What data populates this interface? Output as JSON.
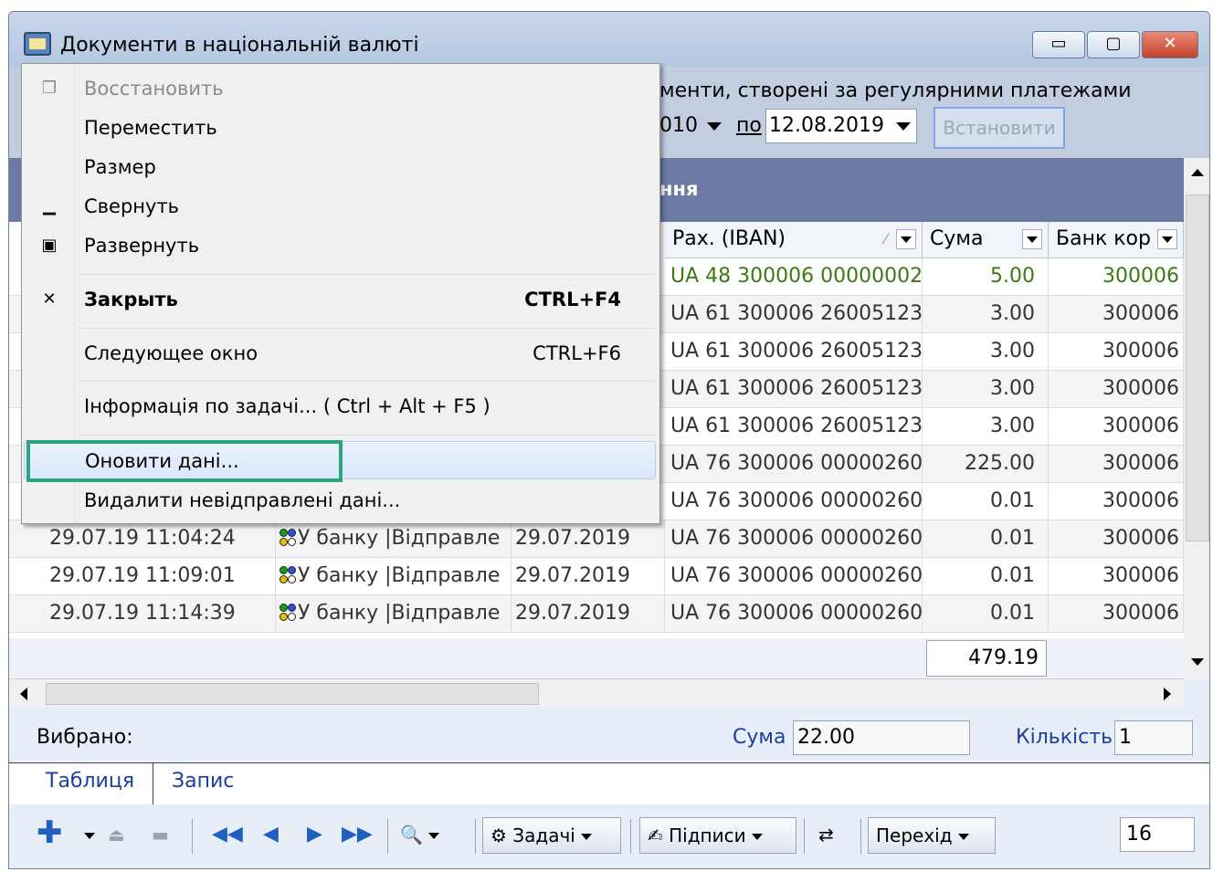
{
  "window": {
    "title": "Документи в національній валюті",
    "controls": {
      "minimize": "▭",
      "maximize": "▢",
      "close": "✕"
    }
  },
  "filter": {
    "title_fragment": "менти, створені за регулярними платежами",
    "date_from_fragment": "010",
    "to_label": "по",
    "date_to": "12.08.2019",
    "apply_button": "Встановити"
  },
  "table": {
    "group_header_fragment": "ння",
    "columns": {
      "iban": "Рах. (IBAN)",
      "sum": "Сума",
      "bank": "Банк кор"
    },
    "rows": [
      {
        "time": "",
        "status": "",
        "date": "",
        "iban": "UA 48 300006 00000002",
        "sum": "5.00",
        "bank": "300006",
        "green": true
      },
      {
        "time": "",
        "status": "",
        "date": "",
        "iban": "UA 61 300006 26005123",
        "sum": "3.00",
        "bank": "300006"
      },
      {
        "time": "",
        "status": "",
        "date": "",
        "iban": "UA 61 300006 26005123",
        "sum": "3.00",
        "bank": "300006"
      },
      {
        "time": "",
        "status": "",
        "date": "",
        "iban": "UA 61 300006 26005123",
        "sum": "3.00",
        "bank": "300006"
      },
      {
        "time": "",
        "status": "",
        "date": "",
        "iban": "UA 61 300006 26005123",
        "sum": "3.00",
        "bank": "300006"
      },
      {
        "time": "",
        "status": "",
        "date": "",
        "iban": "UA 76 300006 00000260",
        "sum": "225.00",
        "bank": "300006"
      },
      {
        "time": "",
        "status": "",
        "date": "",
        "iban": "UA 76 300006 00000260",
        "sum": "0.01",
        "bank": "300006"
      },
      {
        "time": "29.07.19 11:04:24",
        "status": "У банку |Відправле",
        "date": "29.07.2019",
        "iban": "UA 76 300006 00000260",
        "sum": "0.01",
        "bank": "300006"
      },
      {
        "time": "29.07.19 11:09:01",
        "status": "У банку |Відправле",
        "date": "29.07.2019",
        "iban": "UA 76 300006 00000260",
        "sum": "0.01",
        "bank": "300006"
      },
      {
        "time": "29.07.19 11:14:39",
        "status": "У банку |Відправле",
        "date": "29.07.2019",
        "iban": "UA 76 300006 00000260",
        "sum": "0.01",
        "bank": "300006"
      }
    ],
    "total": "479.19"
  },
  "selected": {
    "label": "Вибрано:",
    "sum_label": "Сума",
    "sum_value": "22.00",
    "count_label": "Кількість",
    "count_value": "1"
  },
  "tabs": [
    "Таблиця",
    "Запис"
  ],
  "toolbar": {
    "tasks": "Задачі",
    "signatures": "Підписи",
    "goto": "Перехід",
    "page": "16"
  },
  "menu": {
    "items": {
      "restore": "Восстановить",
      "move": "Переместить",
      "size": "Размер",
      "minimize": "Свернуть",
      "maximize": "Развернуть",
      "close": "Закрыть",
      "close_shortcut": "CTRL+F4",
      "next": "Следующее окно",
      "next_shortcut": "CTRL+F6",
      "info": "Інформація по задачі... ( Ctrl + Alt + F5 )",
      "refresh": "Оновити дані...",
      "delete": "Видалити невідправлені дані..."
    }
  },
  "colors": {
    "highlight_box": "#2ba57c",
    "group_header": "#6b7ba3",
    "green_row_text": "#3b7a11"
  }
}
